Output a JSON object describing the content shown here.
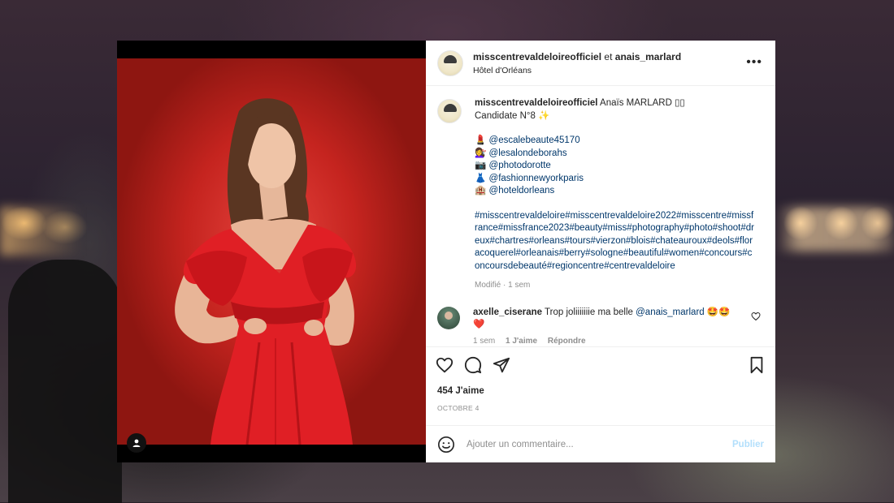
{
  "post": {
    "header": {
      "account": "misscentrevaldeloireofficiel",
      "conjunction": "et",
      "coauthor": "anais_marlard",
      "location": "Hôtel d'Orléans",
      "more_icon": "more-horizontal-icon"
    },
    "caption": {
      "username": "misscentrevaldeloireofficiel",
      "line1_rest": "Anaïs MARLARD ▯▯",
      "line2": "Candidate N°8 ✨",
      "tags": [
        {
          "emoji": "💄",
          "handle": "@escalebeaute45170"
        },
        {
          "emoji": "💇‍♀️",
          "handle": "@lesalondeborahs"
        },
        {
          "emoji": "📷",
          "handle": "@photodorotte"
        },
        {
          "emoji": "👗",
          "handle": "@fashionnewyorkparis"
        },
        {
          "emoji": "🏨",
          "handle": "@hoteldorleans"
        }
      ],
      "hashtags": "#misscentrevaldeloire#misscentrevaldeloire2022#misscentre#missfrance#missfrance2023#beauty#miss#photography#photo#shoot#dreux#chartres#orleans#tours#vierzon#blois#chateauroux#deols#floracoquerel#orleanais#berry#sologne#beautiful#women#concours#concoursdebeauté#regioncentre#centrevaldeloire",
      "meta": "Modifié · 1 sem"
    },
    "comments": [
      {
        "username": "axelle_ciserane",
        "text_before": "Trop joliiiiiiie ma belle",
        "mention": "@anais_marlard",
        "emojis": "🤩🤩",
        "line2": "❤️",
        "time": "1 sem",
        "likes": "1 J'aime",
        "reply": "Répondre"
      }
    ],
    "likes_text": "454 J'aime",
    "date": "OCTOBRE 4",
    "add_comment": {
      "placeholder": "Ajouter un commentaire...",
      "publish": "Publier"
    },
    "colors": {
      "link": "#00376b",
      "publish_disabled": "#b2dffc",
      "photo_bg": "#c5241f",
      "dress": "#e01f25"
    }
  }
}
